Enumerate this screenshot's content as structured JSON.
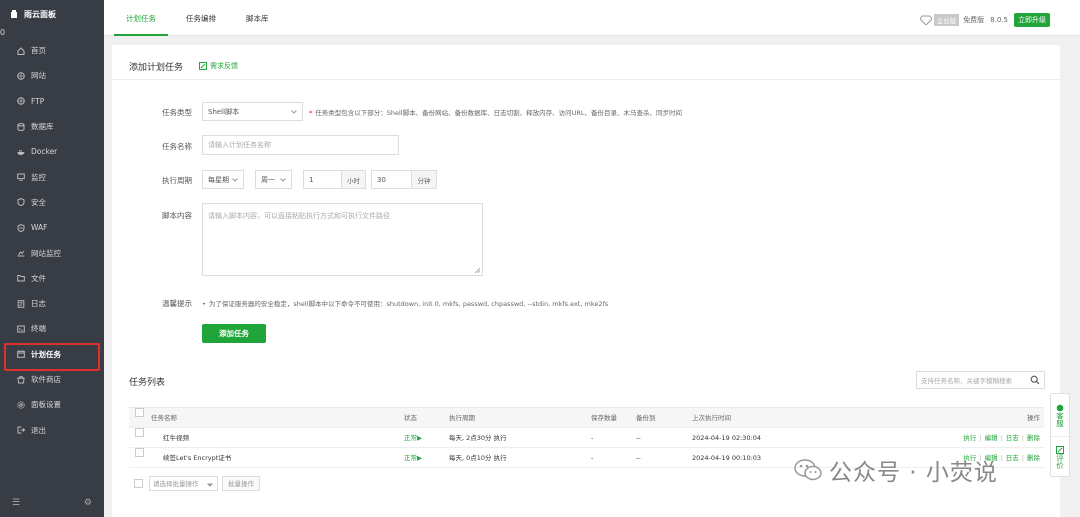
{
  "sidebar": {
    "brand": "雨云面板",
    "badge": "0",
    "items": [
      {
        "label": "首页",
        "icon": "home-icon"
      },
      {
        "label": "网站",
        "icon": "globe-icon"
      },
      {
        "label": "FTP",
        "icon": "globe-icon"
      },
      {
        "label": "数据库",
        "icon": "database-icon"
      },
      {
        "label": "Docker",
        "icon": "docker-icon"
      },
      {
        "label": "监控",
        "icon": "monitor-icon"
      },
      {
        "label": "安全",
        "icon": "shield-icon"
      },
      {
        "label": "WAF",
        "icon": "waf-icon"
      },
      {
        "label": "网站监控",
        "icon": "chart-icon"
      },
      {
        "label": "文件",
        "icon": "folder-icon"
      },
      {
        "label": "日志",
        "icon": "log-icon"
      },
      {
        "label": "终端",
        "icon": "terminal-icon"
      },
      {
        "label": "计划任务",
        "icon": "calendar-icon",
        "active": true
      },
      {
        "label": "软件商店",
        "icon": "store-icon"
      },
      {
        "label": "面板设置",
        "icon": "settings-icon"
      },
      {
        "label": "退出",
        "icon": "logout-icon"
      }
    ]
  },
  "topbar": {
    "tabs": [
      "计划任务",
      "任务编排",
      "脚本库"
    ],
    "edition": "企业版",
    "free": "免费版",
    "version": "8.0.5",
    "upgrade": "立即升级"
  },
  "form": {
    "title": "添加计划任务",
    "feedback": "需求反馈",
    "type_label": "任务类型",
    "type_value": "Shell脚本",
    "type_hint": "任务类型包含以下部分：Shell脚本、备份网站、备份数据库、日志切割、释放内存、访问URL、备份目录、木马查杀、同步时间",
    "name_label": "任务名称",
    "name_placeholder": "请输入计划任务名称",
    "period_label": "执行周期",
    "period_type": "每星期",
    "period_day": "周一",
    "period_hour": "1",
    "hour_unit": "小时",
    "period_minute": "30",
    "minute_unit": "分钟",
    "script_label": "脚本内容",
    "script_placeholder": "请输入脚本内容，可以直接粘贴执行方式和可执行文件路径",
    "tip_label": "温馨提示",
    "tip_text": "为了保证服务器的安全稳定，shell脚本中以下命令不可使用：shutdown, init 0, mkfs, passwd, chpasswd, --stdin, mkfs.ext, mke2fs",
    "submit": "添加任务"
  },
  "list": {
    "title": "任务列表",
    "search_placeholder": "支持任务名称、关键字模糊搜索",
    "columns": [
      "任务名称",
      "状态",
      "执行周期",
      "保存数量",
      "备份到",
      "上次执行时间",
      "操作"
    ],
    "rows": [
      {
        "name": "红牛视频",
        "status": "正常▶",
        "period": "每天, 2点30分 执行",
        "keep": "-",
        "backup": "--",
        "last": "2024-04-19 02:30:04"
      },
      {
        "name": "续签Let's Encrypt证书",
        "status": "正常▶",
        "period": "每天, 0点10分 执行",
        "keep": "-",
        "backup": "--",
        "last": "2024-04-19 00:10:03"
      }
    ],
    "ops": [
      "执行",
      "编辑",
      "日志",
      "删除"
    ],
    "batch_placeholder": "请选择批量操作",
    "batch_button": "批量操作"
  },
  "float": {
    "service": "客服",
    "rate": "评价"
  },
  "watermark": "公众号 · 小荧说",
  "colors": {
    "accent": "#20a53a",
    "sidebar_bg": "#383c44",
    "highlight": "#e0302a"
  }
}
